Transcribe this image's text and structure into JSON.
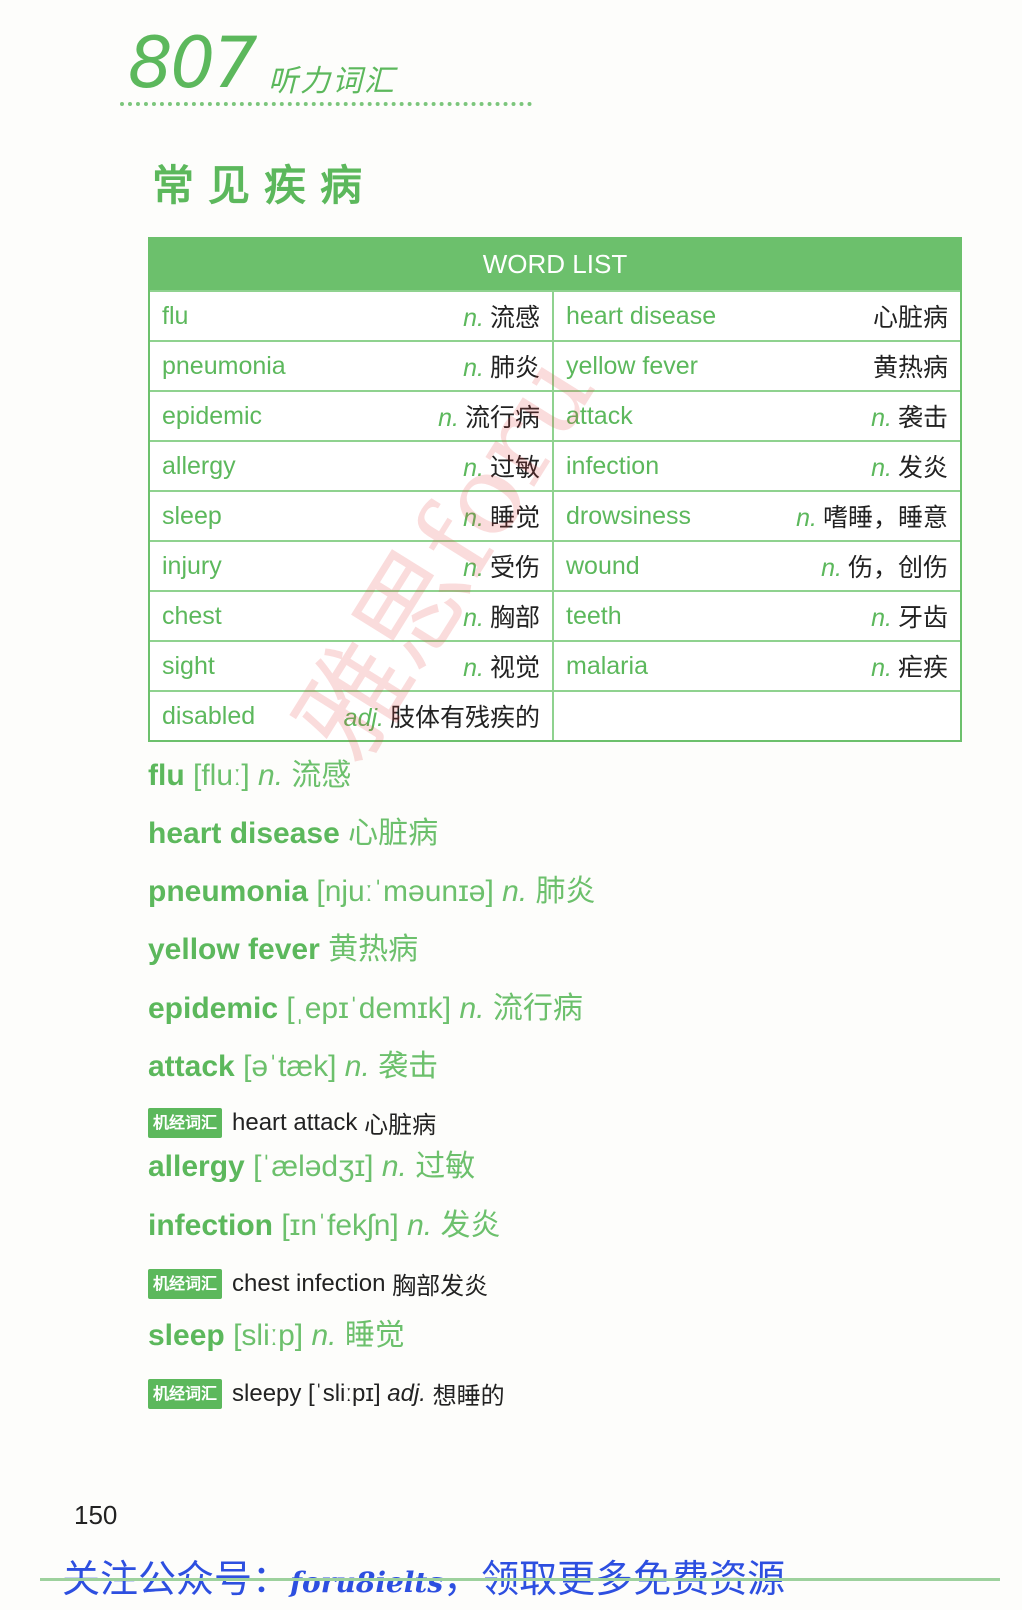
{
  "header": {
    "number": "807",
    "subtitle": "听力词汇"
  },
  "section_title": "常见疾病",
  "word_list": {
    "title": "WORD LIST",
    "rows": [
      {
        "left": {
          "word": "flu",
          "pos": "n.",
          "def": "流感"
        },
        "right": {
          "word": "heart disease",
          "pos": "",
          "def": "心脏病"
        }
      },
      {
        "left": {
          "word": "pneumonia",
          "pos": "n.",
          "def": "肺炎"
        },
        "right": {
          "word": "yellow fever",
          "pos": "",
          "def": "黄热病"
        }
      },
      {
        "left": {
          "word": "epidemic",
          "pos": "n.",
          "def": "流行病"
        },
        "right": {
          "word": "attack",
          "pos": "n.",
          "def": "袭击"
        }
      },
      {
        "left": {
          "word": "allergy",
          "pos": "n.",
          "def": "过敏"
        },
        "right": {
          "word": "infection",
          "pos": "n.",
          "def": "发炎"
        }
      },
      {
        "left": {
          "word": "sleep",
          "pos": "n.",
          "def": "睡觉"
        },
        "right": {
          "word": "drowsiness",
          "pos": "n.",
          "def": "嗜睡，睡意"
        }
      },
      {
        "left": {
          "word": "injury",
          "pos": "n.",
          "def": "受伤"
        },
        "right": {
          "word": "wound",
          "pos": "n.",
          "def": "伤，创伤"
        }
      },
      {
        "left": {
          "word": "chest",
          "pos": "n.",
          "def": "胸部"
        },
        "right": {
          "word": "teeth",
          "pos": "n.",
          "def": "牙齿"
        }
      },
      {
        "left": {
          "word": "sight",
          "pos": "n.",
          "def": "视觉"
        },
        "right": {
          "word": "malaria",
          "pos": "n.",
          "def": "疟疾"
        }
      },
      {
        "left": {
          "word": "disabled",
          "pos": "adj.",
          "def": "肢体有残疾的"
        },
        "right": {
          "word": "",
          "pos": "",
          "def": ""
        }
      }
    ]
  },
  "entries": [
    {
      "headword": "flu",
      "phonetic": "[fluː]",
      "pos": "n.",
      "meaning": "流感"
    },
    {
      "headword": "heart disease",
      "phonetic": "",
      "pos": "",
      "meaning": "心脏病"
    },
    {
      "headword": "pneumonia",
      "phonetic": "[njuːˈməunɪə]",
      "pos": "n.",
      "meaning": "肺炎"
    },
    {
      "headword": "yellow fever",
      "phonetic": "",
      "pos": "",
      "meaning": "黄热病"
    },
    {
      "headword": "epidemic",
      "phonetic": "[ˌepɪˈdemɪk]",
      "pos": "n.",
      "meaning": "流行病"
    },
    {
      "headword": "attack",
      "phonetic": "[əˈtæk]",
      "pos": "n.",
      "meaning": "袭击"
    },
    {
      "headword": "allergy",
      "phonetic": "[ˈælədʒɪ]",
      "pos": "n.",
      "meaning": "过敏"
    },
    {
      "headword": "infection",
      "phonetic": "[ɪnˈfekʃn]",
      "pos": "n.",
      "meaning": "发炎"
    },
    {
      "headword": "sleep",
      "phonetic": "[sliːp]",
      "pos": "n.",
      "meaning": "睡觉"
    }
  ],
  "notes": [
    {
      "badge": "机经词汇",
      "text": "heart attack",
      "pos": "",
      "meaning": "心脏病"
    },
    {
      "badge": "机经词汇",
      "text": "chest infection",
      "pos": "",
      "meaning": "胸部发炎"
    },
    {
      "badge": "机经词汇",
      "text": "sleepy [ˈsliːpɪ]",
      "pos": "adj.",
      "meaning": "想睡的"
    }
  ],
  "page_number": "150",
  "footer_promo": {
    "prefix": "关注公众号：",
    "handle": "foru8ielts",
    "suffix": "，领取更多免费资源"
  },
  "watermark": "雅思foru"
}
